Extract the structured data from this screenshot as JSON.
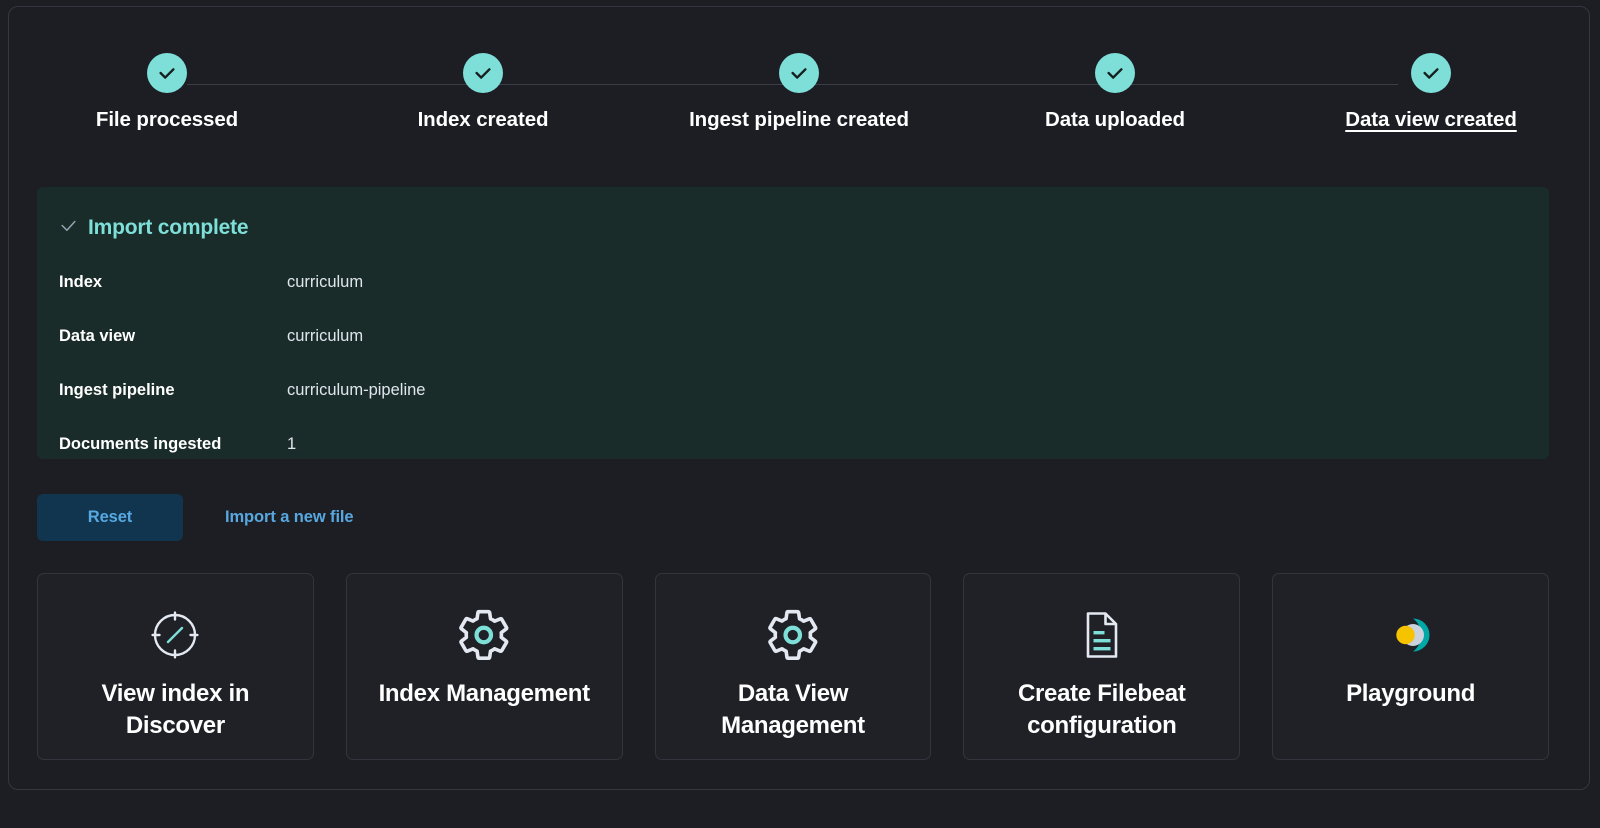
{
  "stepper": {
    "steps": [
      {
        "label": "File processed",
        "state": "complete",
        "icon": "check-icon"
      },
      {
        "label": "Index created",
        "state": "complete",
        "icon": "check-icon"
      },
      {
        "label": "Ingest pipeline created",
        "state": "complete",
        "icon": "check-icon"
      },
      {
        "label": "Data uploaded",
        "state": "complete",
        "icon": "check-icon"
      },
      {
        "label": "Data view created",
        "state": "current",
        "icon": "check-icon"
      }
    ]
  },
  "import_panel": {
    "title": "Import complete",
    "title_icon": "check-icon",
    "rows": [
      {
        "key": "Index",
        "value": "curriculum"
      },
      {
        "key": "Data view",
        "value": "curriculum"
      },
      {
        "key": "Ingest pipeline",
        "value": "curriculum-pipeline"
      },
      {
        "key": "Documents ingested",
        "value": "1"
      }
    ]
  },
  "actions": {
    "reset_label": "Reset",
    "import_new_label": "Import a new file"
  },
  "cards": [
    {
      "title": "View index in Discover",
      "icon": "compass-icon"
    },
    {
      "title": "Index Management",
      "icon": "gear-icon"
    },
    {
      "title": "Data View Management",
      "icon": "gear-icon"
    },
    {
      "title": "Create Filebeat configuration",
      "icon": "document-icon"
    },
    {
      "title": "Playground",
      "icon": "playground-logo-icon"
    }
  ],
  "colors": {
    "page_background": "#1d1e24",
    "panel_border": "#343741",
    "accent_teal": "#7ddfd8",
    "success_panel_background": "#1a2c29",
    "link_blue": "#57a8e0",
    "button_background": "#12354f",
    "text_primary": "#ffffff",
    "playground_yellow": "#f5c300",
    "playground_teal": "#00a9a5",
    "playground_gray": "#cbd2de"
  }
}
